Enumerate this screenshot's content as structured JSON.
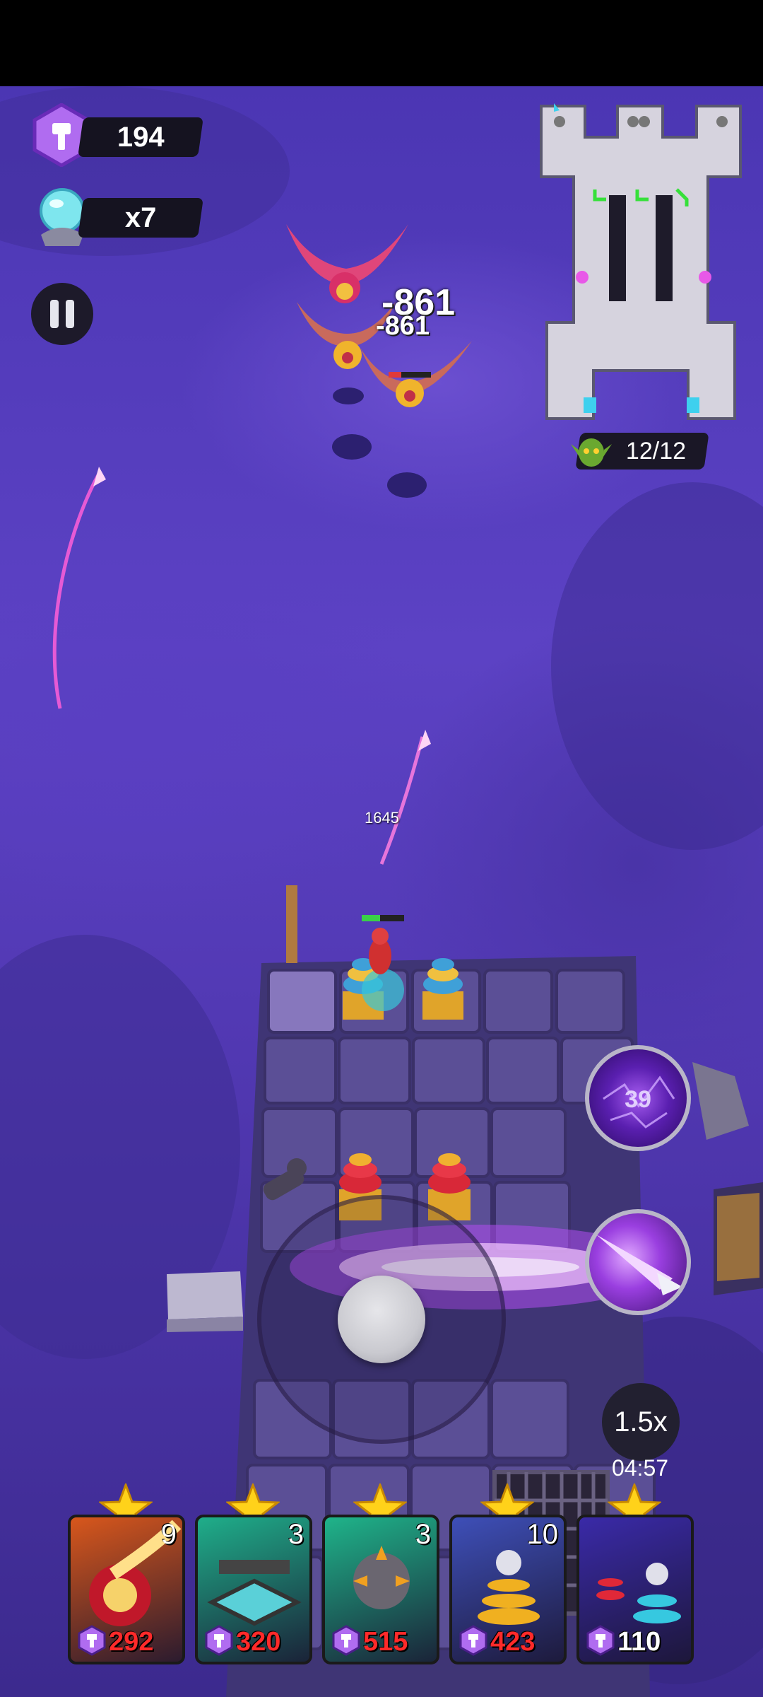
{
  "hud": {
    "gems": "194",
    "orbs": "x7",
    "pause_icon": "pause-icon"
  },
  "minimap": {
    "enemies": "12/12"
  },
  "combat": {
    "damage_big": "-861",
    "damage_small": "-861",
    "hero_hp": "1645"
  },
  "abilities": [
    {
      "name": "arcane-storm",
      "cooldown": "39"
    },
    {
      "name": "void-spear",
      "cooldown": ""
    }
  ],
  "controls": {
    "speed": "1.5x",
    "timer": "04:57"
  },
  "cards": [
    {
      "level": "9",
      "cost": "292",
      "cost_color": "#ff2a2a",
      "theme": "#d8571c"
    },
    {
      "level": "3",
      "cost": "320",
      "cost_color": "#ff2a2a",
      "theme": "#1fae8a"
    },
    {
      "level": "3",
      "cost": "515",
      "cost_color": "#ff2a2a",
      "theme": "#1fb48a"
    },
    {
      "level": "10",
      "cost": "423",
      "cost_color": "#ff2a2a",
      "theme": "#3e4fb8"
    },
    {
      "level": "",
      "cost": "110",
      "cost_color": "#ffffff",
      "theme": "#3a2aa8"
    }
  ]
}
